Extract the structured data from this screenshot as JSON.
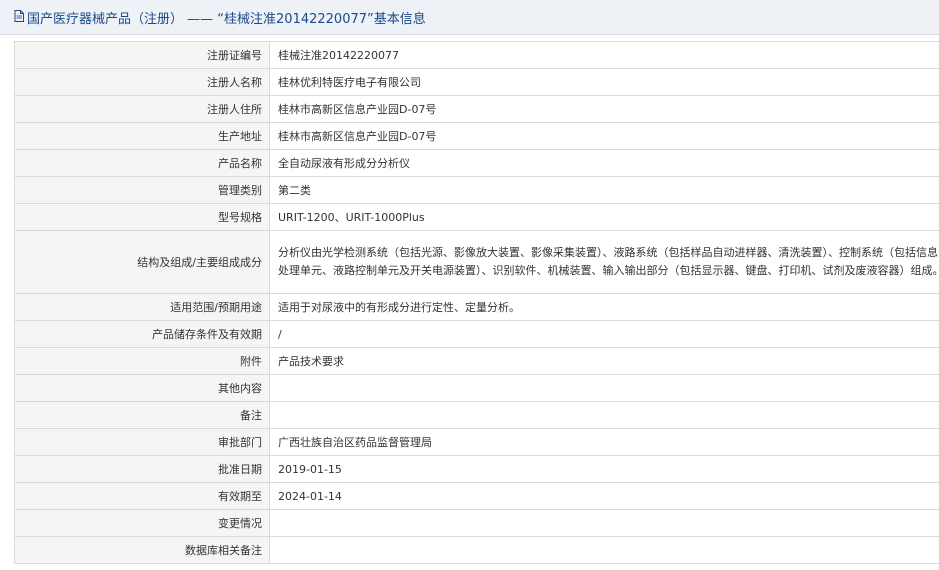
{
  "header": {
    "prefix": "国产医疗器械产品（注册）",
    "separator": " —— ",
    "quote_open": "“",
    "reg_no": "桂械注准20142220077",
    "quote_close": "”",
    "suffix": "基本信息"
  },
  "rows": [
    {
      "label": "注册证编号",
      "value": "桂械注准20142220077"
    },
    {
      "label": "注册人名称",
      "value": "桂林优利特医疗电子有限公司"
    },
    {
      "label": "注册人住所",
      "value": "桂林市高新区信息产业园D-07号"
    },
    {
      "label": "生产地址",
      "value": "桂林市高新区信息产业园D-07号"
    },
    {
      "label": "产品名称",
      "value": "全自动尿液有形成分分析仪"
    },
    {
      "label": "管理类别",
      "value": "第二类"
    },
    {
      "label": "型号规格",
      "value": "URIT-1200、URIT-1000Plus"
    },
    {
      "label": "结构及组成/主要组成成分",
      "value": "分析仪由光学检测系统（包括光源、影像放大装置、影像采集装置）、液路系统（包括样品自动进样器、清洗装置）、控制系统（包括信息处理单元、液路控制单元及开关电源装置）、识别软件、机械装置、输入输出部分（包括显示器、键盘、打印机、试剂及废液容器）组成。"
    },
    {
      "label": "适用范围/预期用途",
      "value": "适用于对尿液中的有形成分进行定性、定量分析。"
    },
    {
      "label": "产品储存条件及有效期",
      "value": "/"
    },
    {
      "label": "附件",
      "value": "产品技术要求"
    },
    {
      "label": "其他内容",
      "value": ""
    },
    {
      "label": "备注",
      "value": ""
    },
    {
      "label": "审批部门",
      "value": "广西壮族自治区药品监督管理局"
    },
    {
      "label": "批准日期",
      "value": "2019-01-15"
    },
    {
      "label": "有效期至",
      "value": "2024-01-14"
    },
    {
      "label": "变更情况",
      "value": ""
    },
    {
      "label": "数据库相关备注",
      "value": ""
    }
  ],
  "colors": {
    "title_text": "#1a4a8a",
    "title_bg": "#eef1f6",
    "label_bg": "#f5f5f5",
    "border": "#d9d9d9",
    "text": "#333333"
  },
  "icons": {
    "title_icon": "document-icon"
  }
}
